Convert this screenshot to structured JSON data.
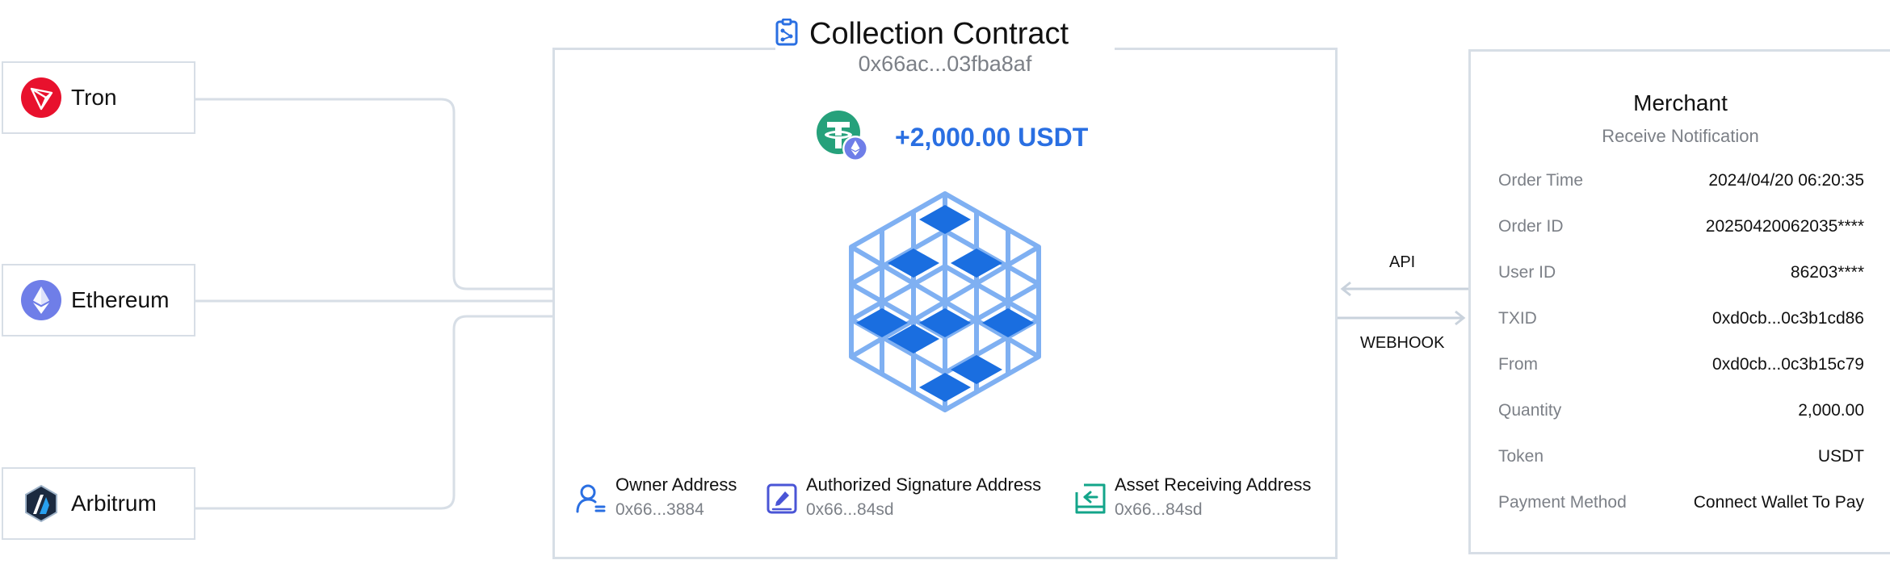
{
  "colors": {
    "border": "#d7dee6",
    "accent_blue": "#2a6fe2",
    "muted_text": "#7c8087",
    "tron_red": "#e8112d",
    "ethereum_purple": "#6f7ee8",
    "tether_green": "#26a17b",
    "hex_light_blue": "#7fb0f2",
    "hex_dark_blue": "#1a6ee0"
  },
  "chains": [
    {
      "name": "Tron",
      "icon": "tron-logo-icon"
    },
    {
      "name": "Ethereum",
      "icon": "ethereum-logo-icon"
    },
    {
      "name": "Arbitrum",
      "icon": "arbitrum-logo-icon"
    }
  ],
  "contract": {
    "title": "Collection Contract",
    "title_icon": "contract-document-icon",
    "address": "0x66ac...03fba8af",
    "deposit_amount": "+2,000.00 USDT",
    "token_icon": "tether-usdt-icon",
    "center_icon": "hexagon-cube-grid-icon",
    "addresses": [
      {
        "label": "Owner Address",
        "value": "0x66...3884",
        "icon": "owner-user-icon"
      },
      {
        "label": "Authorized Signature Address",
        "value": "0x66...84sd",
        "icon": "signature-pen-icon"
      },
      {
        "label": "Asset Receiving Address",
        "value": "0x66...84sd",
        "icon": "receive-box-icon"
      }
    ]
  },
  "links": {
    "api_label": "API",
    "webhook_label": "WEBHOOK"
  },
  "merchant": {
    "title": "Merchant",
    "subtitle": "Receive Notification",
    "fields": [
      {
        "key": "Order Time",
        "value": "2024/04/20 06:20:35"
      },
      {
        "key": "Order ID",
        "value": "20250420062035****"
      },
      {
        "key": "User ID",
        "value": "86203****"
      },
      {
        "key": "TXID",
        "value": "0xd0cb...0c3b1cd86"
      },
      {
        "key": "From",
        "value": "0xd0cb...0c3b15c79"
      },
      {
        "key": "Quantity",
        "value": "2,000.00"
      },
      {
        "key": "Token",
        "value": "USDT"
      },
      {
        "key": "Payment Method",
        "value": "Connect Wallet To Pay"
      }
    ]
  }
}
